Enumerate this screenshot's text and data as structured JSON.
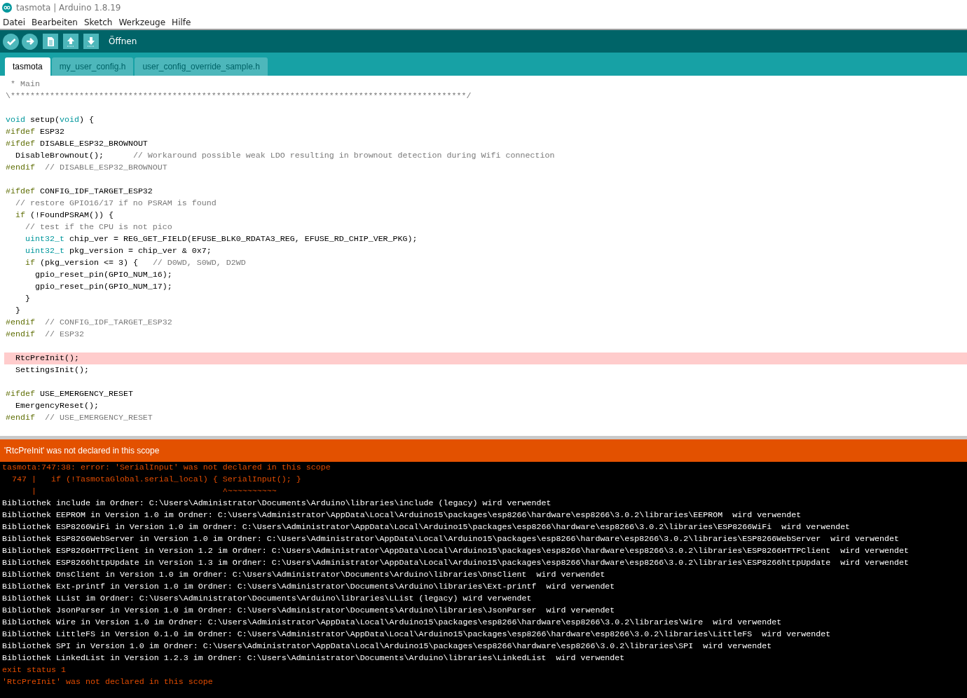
{
  "window": {
    "title": "tasmota | Arduino 1.8.19"
  },
  "menu": [
    "Datei",
    "Bearbeiten",
    "Sketch",
    "Werkzeuge",
    "Hilfe"
  ],
  "toolbar": {
    "buttons": [
      {
        "kind": "verify"
      },
      {
        "kind": "upload"
      },
      {
        "kind": "new"
      },
      {
        "kind": "open"
      },
      {
        "kind": "save"
      }
    ],
    "hint": "Öffnen"
  },
  "tabs": [
    {
      "label": "tasmota",
      "selected": true
    },
    {
      "label": "my_user_config.h",
      "selected": false
    },
    {
      "label": "user_config_override_sample.h",
      "selected": false
    }
  ],
  "editor": {
    "lines": [
      {
        "kind": "code",
        "highlighted": false,
        "parts": [
          {
            "text": " * Main",
            "kind": "comment"
          }
        ]
      },
      {
        "kind": "code",
        "highlighted": false,
        "parts": [
          {
            "text": "\\*********************************************************************************************/",
            "kind": "comment"
          }
        ]
      },
      {
        "kind": "blank"
      },
      {
        "kind": "code",
        "highlighted": false,
        "parts": [
          {
            "text": "void",
            "kind": "type"
          },
          {
            "text": " setup(",
            "kind": "plain"
          },
          {
            "text": "void",
            "kind": "type"
          },
          {
            "text": ") {",
            "kind": "plain"
          }
        ]
      },
      {
        "kind": "code",
        "highlighted": false,
        "parts": [
          {
            "text": "#ifdef",
            "kind": "preproc"
          },
          {
            "text": " ESP32",
            "kind": "plain"
          }
        ]
      },
      {
        "kind": "code",
        "highlighted": false,
        "parts": [
          {
            "text": "#ifdef",
            "kind": "preproc"
          },
          {
            "text": " DISABLE_ESP32_BROWNOUT",
            "kind": "plain"
          }
        ]
      },
      {
        "kind": "code",
        "highlighted": false,
        "parts": [
          {
            "text": "  DisableBrownout();      ",
            "kind": "plain"
          },
          {
            "text": "// Workaround possible weak LDO resulting in brownout detection during Wifi connection",
            "kind": "comment"
          }
        ]
      },
      {
        "kind": "code",
        "highlighted": false,
        "parts": [
          {
            "text": "#endif",
            "kind": "preproc"
          },
          {
            "text": "  // DISABLE_ESP32_BROWNOUT",
            "kind": "comment"
          }
        ]
      },
      {
        "kind": "blank"
      },
      {
        "kind": "code",
        "highlighted": false,
        "parts": [
          {
            "text": "#ifdef",
            "kind": "preproc"
          },
          {
            "text": " CONFIG_IDF_TARGET_ESP32",
            "kind": "plain"
          }
        ]
      },
      {
        "kind": "code",
        "highlighted": false,
        "parts": [
          {
            "text": "  // restore GPIO16/17 if no PSRAM is found",
            "kind": "comment"
          }
        ]
      },
      {
        "kind": "code",
        "highlighted": false,
        "parts": [
          {
            "text": "  if",
            "kind": "preproc"
          },
          {
            "text": " (!FoundPSRAM()) {",
            "kind": "plain"
          }
        ]
      },
      {
        "kind": "code",
        "highlighted": false,
        "parts": [
          {
            "text": "    // test if the CPU is not pico",
            "kind": "comment"
          }
        ]
      },
      {
        "kind": "code",
        "highlighted": false,
        "parts": [
          {
            "text": "    uint32_t",
            "kind": "type"
          },
          {
            "text": " chip_ver = REG_GET_FIELD(EFUSE_BLK0_RDATA3_REG, EFUSE_RD_CHIP_VER_PKG);",
            "kind": "plain"
          }
        ]
      },
      {
        "kind": "code",
        "highlighted": false,
        "parts": [
          {
            "text": "    uint32_t",
            "kind": "type"
          },
          {
            "text": " pkg_version = chip_ver & 0x7;",
            "kind": "plain"
          }
        ]
      },
      {
        "kind": "code",
        "highlighted": false,
        "parts": [
          {
            "text": "    if",
            "kind": "preproc"
          },
          {
            "text": " (pkg_version <= 3) {   ",
            "kind": "plain"
          },
          {
            "text": "// D0WD, S0WD, D2WD",
            "kind": "comment"
          }
        ]
      },
      {
        "kind": "code",
        "highlighted": false,
        "parts": [
          {
            "text": "      gpio_reset_pin(GPIO_NUM_16);",
            "kind": "plain"
          }
        ]
      },
      {
        "kind": "code",
        "highlighted": false,
        "parts": [
          {
            "text": "      gpio_reset_pin(GPIO_NUM_17);",
            "kind": "plain"
          }
        ]
      },
      {
        "kind": "code",
        "highlighted": false,
        "parts": [
          {
            "text": "    }",
            "kind": "plain"
          }
        ]
      },
      {
        "kind": "code",
        "highlighted": false,
        "parts": [
          {
            "text": "  }",
            "kind": "plain"
          }
        ]
      },
      {
        "kind": "code",
        "highlighted": false,
        "parts": [
          {
            "text": "#endif",
            "kind": "preproc"
          },
          {
            "text": "  // CONFIG_IDF_TARGET_ESP32",
            "kind": "comment"
          }
        ]
      },
      {
        "kind": "code",
        "highlighted": false,
        "parts": [
          {
            "text": "#endif",
            "kind": "preproc"
          },
          {
            "text": "  // ESP32",
            "kind": "comment"
          }
        ]
      },
      {
        "kind": "blank"
      },
      {
        "kind": "code",
        "highlighted": true,
        "parts": [
          {
            "text": "  RtcPreInit();",
            "kind": "plain"
          }
        ]
      },
      {
        "kind": "code",
        "highlighted": false,
        "parts": [
          {
            "text": "  SettingsInit();",
            "kind": "plain"
          }
        ]
      },
      {
        "kind": "blank"
      },
      {
        "kind": "code",
        "highlighted": false,
        "parts": [
          {
            "text": "#ifdef",
            "kind": "preproc"
          },
          {
            "text": " USE_EMERGENCY_RESET",
            "kind": "plain"
          }
        ]
      },
      {
        "kind": "code",
        "highlighted": false,
        "parts": [
          {
            "text": "  EmergencyReset();",
            "kind": "plain"
          }
        ]
      },
      {
        "kind": "code",
        "highlighted": false,
        "parts": [
          {
            "text": "#endif",
            "kind": "preproc"
          },
          {
            "text": "  // USE_EMERGENCY_RESET",
            "kind": "comment"
          }
        ]
      }
    ]
  },
  "status_bar": {
    "message": "'RtcPreInit' was not declared in this scope",
    "kind": "error"
  },
  "console": {
    "lines": [
      {
        "kind": "error",
        "text": "tasmota:747:38: error: 'SerialInput' was not declared in this scope"
      },
      {
        "kind": "error",
        "text": "  747 |   if (!TasmotaGlobal.serial_local) { SerialInput(); }"
      },
      {
        "kind": "error",
        "text": "      |                                      ^~~~~~~~~~~"
      },
      {
        "kind": "info",
        "text": "Bibliothek include im Ordner: C:\\Users\\Administrator\\Documents\\Arduino\\libraries\\include (legacy) wird verwendet"
      },
      {
        "kind": "info",
        "text": "Bibliothek EEPROM in Version 1.0 im Ordner: C:\\Users\\Administrator\\AppData\\Local\\Arduino15\\packages\\esp8266\\hardware\\esp8266\\3.0.2\\libraries\\EEPROM  wird verwendet"
      },
      {
        "kind": "info",
        "text": "Bibliothek ESP8266WiFi in Version 1.0 im Ordner: C:\\Users\\Administrator\\AppData\\Local\\Arduino15\\packages\\esp8266\\hardware\\esp8266\\3.0.2\\libraries\\ESP8266WiFi  wird verwendet"
      },
      {
        "kind": "info",
        "text": "Bibliothek ESP8266WebServer in Version 1.0 im Ordner: C:\\Users\\Administrator\\AppData\\Local\\Arduino15\\packages\\esp8266\\hardware\\esp8266\\3.0.2\\libraries\\ESP8266WebServer  wird verwendet"
      },
      {
        "kind": "info",
        "text": "Bibliothek ESP8266HTTPClient in Version 1.2 im Ordner: C:\\Users\\Administrator\\AppData\\Local\\Arduino15\\packages\\esp8266\\hardware\\esp8266\\3.0.2\\libraries\\ESP8266HTTPClient  wird verwendet"
      },
      {
        "kind": "info",
        "text": "Bibliothek ESP8266httpUpdate in Version 1.3 im Ordner: C:\\Users\\Administrator\\AppData\\Local\\Arduino15\\packages\\esp8266\\hardware\\esp8266\\3.0.2\\libraries\\ESP8266httpUpdate  wird verwendet"
      },
      {
        "kind": "info",
        "text": "Bibliothek DnsClient in Version 1.0 im Ordner: C:\\Users\\Administrator\\Documents\\Arduino\\libraries\\DnsClient  wird verwendet"
      },
      {
        "kind": "info",
        "text": "Bibliothek Ext-printf in Version 1.0 im Ordner: C:\\Users\\Administrator\\Documents\\Arduino\\libraries\\Ext-printf  wird verwendet"
      },
      {
        "kind": "info",
        "text": "Bibliothek LList im Ordner: C:\\Users\\Administrator\\Documents\\Arduino\\libraries\\LList (legacy) wird verwendet"
      },
      {
        "kind": "info",
        "text": "Bibliothek JsonParser in Version 1.0 im Ordner: C:\\Users\\Administrator\\Documents\\Arduino\\libraries\\JsonParser  wird verwendet"
      },
      {
        "kind": "info",
        "text": "Bibliothek Wire in Version 1.0 im Ordner: C:\\Users\\Administrator\\AppData\\Local\\Arduino15\\packages\\esp8266\\hardware\\esp8266\\3.0.2\\libraries\\Wire  wird verwendet"
      },
      {
        "kind": "info",
        "text": "Bibliothek LittleFS in Version 0.1.0 im Ordner: C:\\Users\\Administrator\\AppData\\Local\\Arduino15\\packages\\esp8266\\hardware\\esp8266\\3.0.2\\libraries\\LittleFS  wird verwendet"
      },
      {
        "kind": "info",
        "text": "Bibliothek SPI in Version 1.0 im Ordner: C:\\Users\\Administrator\\AppData\\Local\\Arduino15\\packages\\esp8266\\hardware\\esp8266\\3.0.2\\libraries\\SPI  wird verwendet"
      },
      {
        "kind": "info",
        "text": "Bibliothek LinkedList in Version 1.2.3 im Ordner: C:\\Users\\Administrator\\Documents\\Arduino\\libraries\\LinkedList  wird verwendet"
      },
      {
        "kind": "error",
        "text": "exit status 1"
      },
      {
        "kind": "error",
        "text": "'RtcPreInit' was not declared in this scope"
      }
    ]
  }
}
